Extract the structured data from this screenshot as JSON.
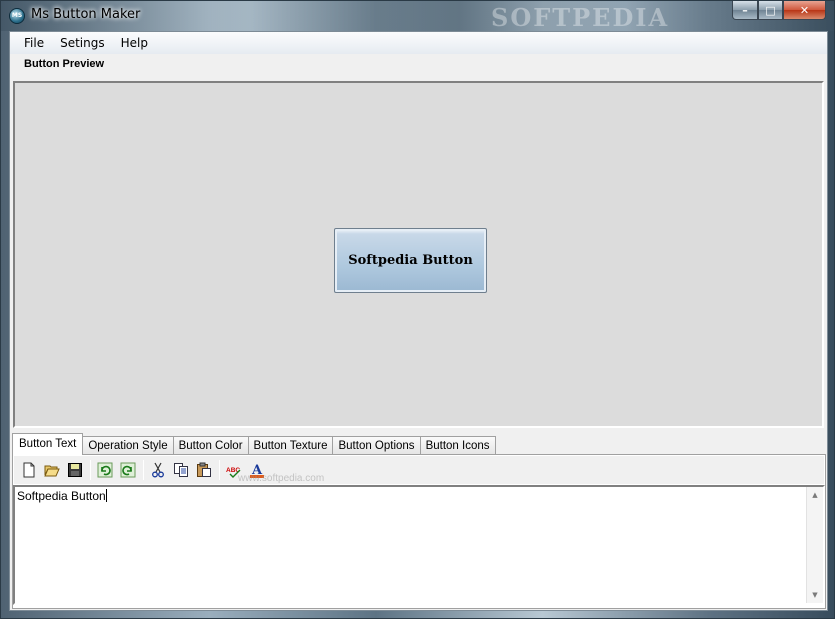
{
  "window": {
    "title": "Ms Button Maker",
    "app_icon_text": "MS",
    "watermark": "SOFTPEDIA",
    "caption": {
      "minimize": "–",
      "maximize": "□",
      "close": "✕"
    }
  },
  "menu": [
    "File",
    "Setings",
    "Help"
  ],
  "preview": {
    "label": "Button Preview",
    "button_text": "Softpedia Button"
  },
  "tabs": [
    "Button Text",
    "Operation Style",
    "Button Color",
    "Button Texture",
    "Button Options",
    "Button Icons"
  ],
  "panel_watermark": "www.softpedia.com",
  "toolbar": {
    "icons": [
      "new-icon",
      "open-icon",
      "save-icon",
      "undo-icon",
      "redo-icon",
      "cut-icon",
      "copy-icon",
      "paste-icon",
      "spellcheck-icon",
      "font-color-icon"
    ],
    "spell_text": "ABC",
    "font_color_letter": "A"
  },
  "editor": {
    "text": "Softpedia Button"
  },
  "colors": {
    "preview_bg": "#dcdcdc",
    "button_gradient_top": "#c8d8e8",
    "button_gradient_bottom": "#9bb8d2",
    "close_button": "#c94a2c",
    "font_color_bar": "#e05a1a"
  }
}
